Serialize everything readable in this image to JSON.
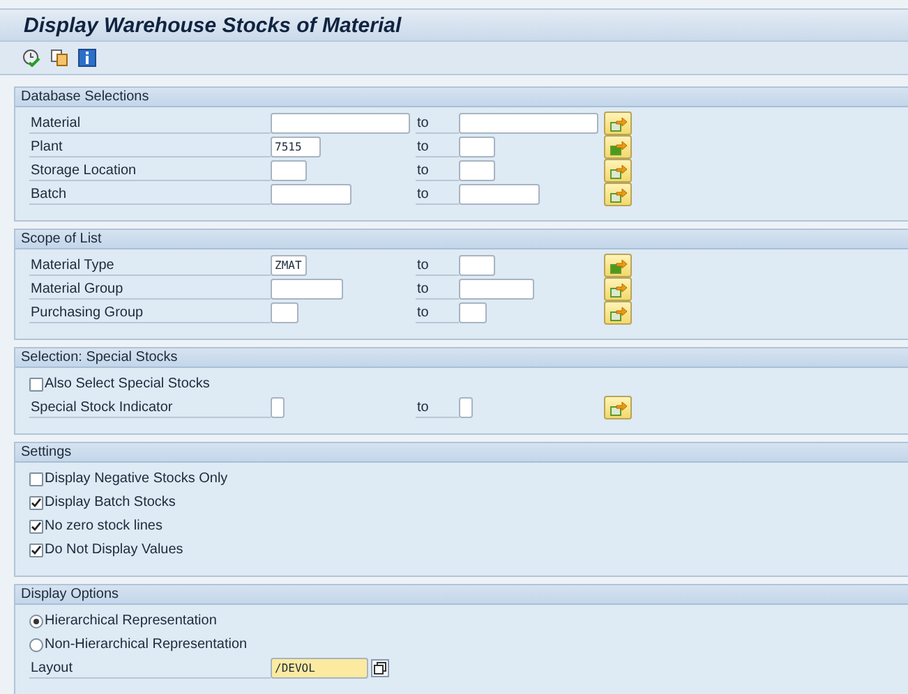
{
  "title": "Display Warehouse Stocks of Material",
  "toolbar": [
    {
      "kind": "execute"
    },
    {
      "kind": "variant"
    },
    {
      "kind": "info"
    }
  ],
  "sections": [
    {
      "title": "Database Selections",
      "rows": [
        {
          "kind": "range",
          "label": "Material",
          "low": "",
          "to": "to",
          "high": "",
          "active": false
        },
        {
          "kind": "range",
          "label": "Plant",
          "low": "7515",
          "to": "to",
          "high": "",
          "active": true
        },
        {
          "kind": "range",
          "label": "Storage Location",
          "low": "",
          "to": "to",
          "high": "",
          "active": false
        },
        {
          "kind": "range",
          "label": "Batch",
          "low": "",
          "to": "to",
          "high": "",
          "active": false
        }
      ]
    },
    {
      "title": "Scope of List",
      "rows": [
        {
          "kind": "range",
          "label": "Material Type",
          "low": "ZMAT",
          "to": "to",
          "high": "",
          "active": true
        },
        {
          "kind": "range",
          "label": "Material Group",
          "low": "",
          "to": "to",
          "high": "",
          "active": false
        },
        {
          "kind": "range",
          "label": "Purchasing Group",
          "low": "",
          "to": "to",
          "high": "",
          "active": false
        }
      ]
    },
    {
      "title": "Selection: Special Stocks",
      "rows": [
        {
          "kind": "checkbox",
          "label": "Also Select Special Stocks",
          "checked": false
        },
        {
          "kind": "range",
          "label": "Special Stock Indicator",
          "low": "",
          "to": "to",
          "high": "",
          "active": false
        }
      ]
    },
    {
      "title": "Settings",
      "rows": [
        {
          "kind": "checkbox",
          "label": "Display Negative Stocks Only",
          "checked": false
        },
        {
          "kind": "checkbox",
          "label": "Display Batch Stocks",
          "checked": true
        },
        {
          "kind": "checkbox",
          "label": "No zero stock lines",
          "checked": true
        },
        {
          "kind": "checkbox",
          "label": "Do Not Display Values",
          "checked": true
        }
      ]
    },
    {
      "title": "Display Options",
      "rows": [
        {
          "kind": "radio",
          "label": "Hierarchical Representation",
          "selected": true
        },
        {
          "kind": "radio",
          "label": "Non-Hierarchical Representation",
          "selected": false
        },
        {
          "kind": "layout",
          "label": "Layout",
          "value": "/DEVOL"
        }
      ]
    }
  ]
}
